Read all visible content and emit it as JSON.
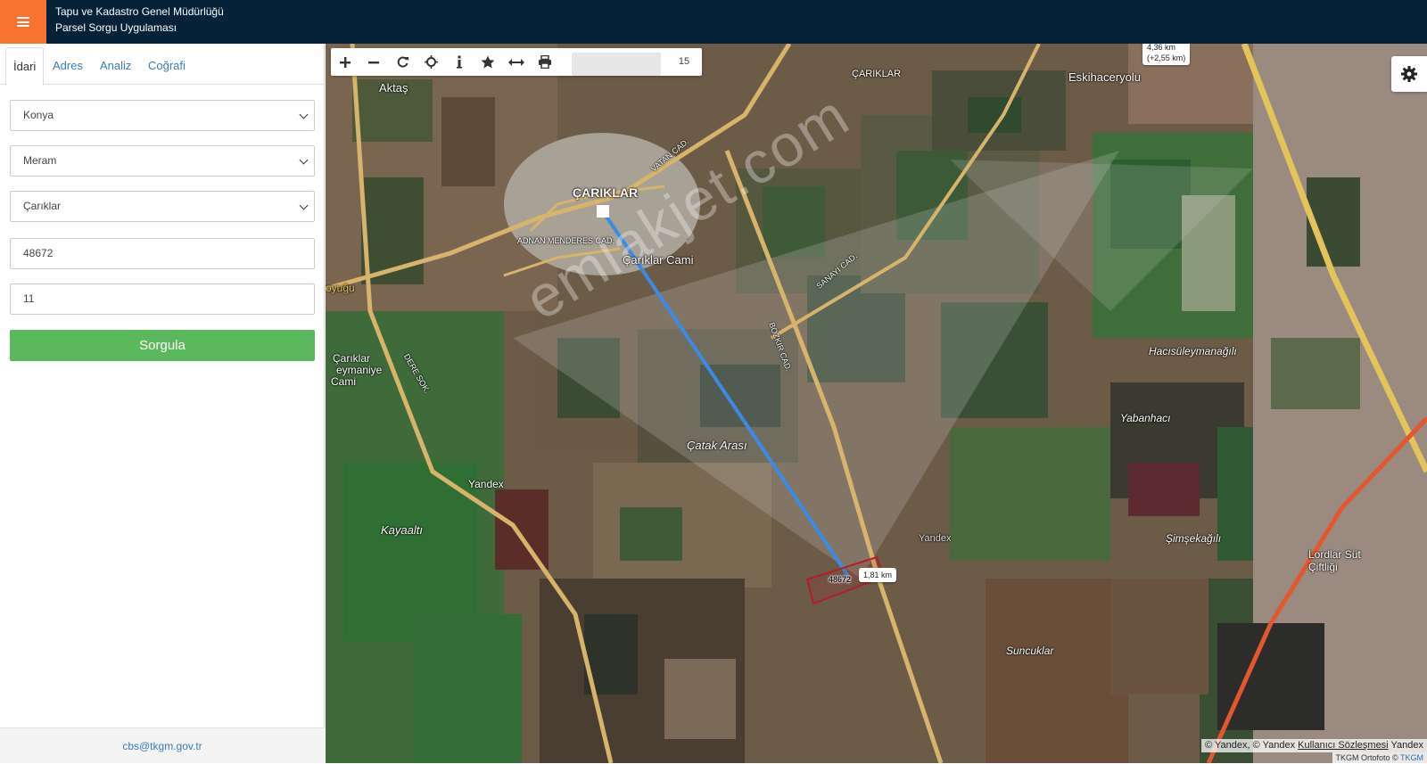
{
  "header": {
    "title_line1": "Tapu ve Kadastro Genel Müdürlüğü",
    "title_line2": "Parsel Sorgu Uygulaması"
  },
  "sidebar": {
    "tabs": [
      {
        "label": "İdari"
      },
      {
        "label": "Adres"
      },
      {
        "label": "Analiz"
      },
      {
        "label": "Coğrafi"
      }
    ],
    "province": "Konya",
    "district": "Meram",
    "neighborhood": "Çarıklar",
    "block": "48672",
    "parcel": "11",
    "submit_label": "Sorgula",
    "footer_email": "cbs@tkgm.gov.tr"
  },
  "map": {
    "toolbar_icons": [
      "plus-icon",
      "minus-icon",
      "refresh-icon",
      "crosshair-icon",
      "info-icon",
      "star-icon",
      "measure-icon",
      "print-icon"
    ],
    "zoom_level": "15",
    "top_tooltip_line1": "4,36 km",
    "top_tooltip_line2": "(+2,55 km)",
    "distance_label": "1,81 km",
    "parcel_label": "48672",
    "watermark": "emlakjet.com",
    "place_labels": {
      "cariklar": "ÇARIKLAR",
      "cariklar_top": "ÇARIKLAR",
      "cariklar_cami": "Çarıklar Cami",
      "aktas": "Aktaş",
      "eskihaceryolu": "Eskihaceryolu",
      "catak_arasi": "Çatak Arası",
      "kayaalti": "Kayaaltı",
      "yandex1": "Yandex",
      "yandex2": "Yandex",
      "hacisuleymanagili": "Hacısüleymanağılı",
      "yabanhaci": "Yabanhacı",
      "simsekagili": "Şimşekağılı",
      "suncuklar": "Suncuklar",
      "lordlar": "Lordlar Süt",
      "ciftligi": "Çiftliği",
      "cariklar_suleymaniye": "Çarıklar",
      "suleymaniye": "eymaniye",
      "cami2": "Cami",
      "oyugu": "oyuğu",
      "bozkir_cad": "BOZKIR CAD.",
      "sanayi_cad": "SANAYİ CAD.",
      "vatan_cad": "VATAN CAD.",
      "adnan_menderes": "ADNAN MENDERES CAD.",
      "dere_sok": "DERE SOK."
    },
    "attribution_main": "© Yandex, © Yandex",
    "attribution_link": "Kullanıcı Sözleşmesi",
    "attribution_tail": "Yandex",
    "attribution_ortho": "TKGM Ortofoto ©",
    "attribution_ortho_link": "TKGM"
  }
}
